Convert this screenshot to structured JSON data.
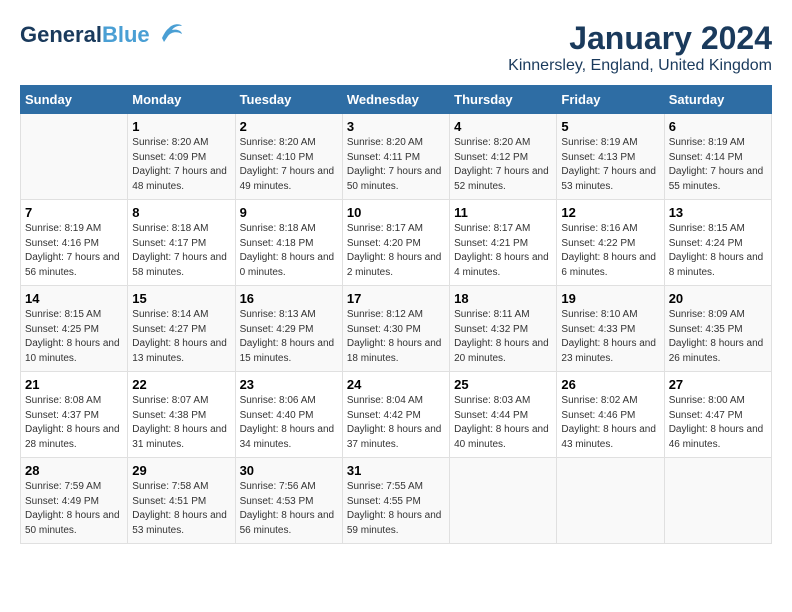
{
  "header": {
    "logo_general": "General",
    "logo_blue": "Blue",
    "main_title": "January 2024",
    "subtitle": "Kinnersley, England, United Kingdom"
  },
  "days_header": [
    "Sunday",
    "Monday",
    "Tuesday",
    "Wednesday",
    "Thursday",
    "Friday",
    "Saturday"
  ],
  "weeks": [
    [
      {
        "date": "",
        "sunrise": "",
        "sunset": "",
        "daylight": ""
      },
      {
        "date": "1",
        "sunrise": "Sunrise: 8:20 AM",
        "sunset": "Sunset: 4:09 PM",
        "daylight": "Daylight: 7 hours and 48 minutes."
      },
      {
        "date": "2",
        "sunrise": "Sunrise: 8:20 AM",
        "sunset": "Sunset: 4:10 PM",
        "daylight": "Daylight: 7 hours and 49 minutes."
      },
      {
        "date": "3",
        "sunrise": "Sunrise: 8:20 AM",
        "sunset": "Sunset: 4:11 PM",
        "daylight": "Daylight: 7 hours and 50 minutes."
      },
      {
        "date": "4",
        "sunrise": "Sunrise: 8:20 AM",
        "sunset": "Sunset: 4:12 PM",
        "daylight": "Daylight: 7 hours and 52 minutes."
      },
      {
        "date": "5",
        "sunrise": "Sunrise: 8:19 AM",
        "sunset": "Sunset: 4:13 PM",
        "daylight": "Daylight: 7 hours and 53 minutes."
      },
      {
        "date": "6",
        "sunrise": "Sunrise: 8:19 AM",
        "sunset": "Sunset: 4:14 PM",
        "daylight": "Daylight: 7 hours and 55 minutes."
      }
    ],
    [
      {
        "date": "7",
        "sunrise": "Sunrise: 8:19 AM",
        "sunset": "Sunset: 4:16 PM",
        "daylight": "Daylight: 7 hours and 56 minutes."
      },
      {
        "date": "8",
        "sunrise": "Sunrise: 8:18 AM",
        "sunset": "Sunset: 4:17 PM",
        "daylight": "Daylight: 7 hours and 58 minutes."
      },
      {
        "date": "9",
        "sunrise": "Sunrise: 8:18 AM",
        "sunset": "Sunset: 4:18 PM",
        "daylight": "Daylight: 8 hours and 0 minutes."
      },
      {
        "date": "10",
        "sunrise": "Sunrise: 8:17 AM",
        "sunset": "Sunset: 4:20 PM",
        "daylight": "Daylight: 8 hours and 2 minutes."
      },
      {
        "date": "11",
        "sunrise": "Sunrise: 8:17 AM",
        "sunset": "Sunset: 4:21 PM",
        "daylight": "Daylight: 8 hours and 4 minutes."
      },
      {
        "date": "12",
        "sunrise": "Sunrise: 8:16 AM",
        "sunset": "Sunset: 4:22 PM",
        "daylight": "Daylight: 8 hours and 6 minutes."
      },
      {
        "date": "13",
        "sunrise": "Sunrise: 8:15 AM",
        "sunset": "Sunset: 4:24 PM",
        "daylight": "Daylight: 8 hours and 8 minutes."
      }
    ],
    [
      {
        "date": "14",
        "sunrise": "Sunrise: 8:15 AM",
        "sunset": "Sunset: 4:25 PM",
        "daylight": "Daylight: 8 hours and 10 minutes."
      },
      {
        "date": "15",
        "sunrise": "Sunrise: 8:14 AM",
        "sunset": "Sunset: 4:27 PM",
        "daylight": "Daylight: 8 hours and 13 minutes."
      },
      {
        "date": "16",
        "sunrise": "Sunrise: 8:13 AM",
        "sunset": "Sunset: 4:29 PM",
        "daylight": "Daylight: 8 hours and 15 minutes."
      },
      {
        "date": "17",
        "sunrise": "Sunrise: 8:12 AM",
        "sunset": "Sunset: 4:30 PM",
        "daylight": "Daylight: 8 hours and 18 minutes."
      },
      {
        "date": "18",
        "sunrise": "Sunrise: 8:11 AM",
        "sunset": "Sunset: 4:32 PM",
        "daylight": "Daylight: 8 hours and 20 minutes."
      },
      {
        "date": "19",
        "sunrise": "Sunrise: 8:10 AM",
        "sunset": "Sunset: 4:33 PM",
        "daylight": "Daylight: 8 hours and 23 minutes."
      },
      {
        "date": "20",
        "sunrise": "Sunrise: 8:09 AM",
        "sunset": "Sunset: 4:35 PM",
        "daylight": "Daylight: 8 hours and 26 minutes."
      }
    ],
    [
      {
        "date": "21",
        "sunrise": "Sunrise: 8:08 AM",
        "sunset": "Sunset: 4:37 PM",
        "daylight": "Daylight: 8 hours and 28 minutes."
      },
      {
        "date": "22",
        "sunrise": "Sunrise: 8:07 AM",
        "sunset": "Sunset: 4:38 PM",
        "daylight": "Daylight: 8 hours and 31 minutes."
      },
      {
        "date": "23",
        "sunrise": "Sunrise: 8:06 AM",
        "sunset": "Sunset: 4:40 PM",
        "daylight": "Daylight: 8 hours and 34 minutes."
      },
      {
        "date": "24",
        "sunrise": "Sunrise: 8:04 AM",
        "sunset": "Sunset: 4:42 PM",
        "daylight": "Daylight: 8 hours and 37 minutes."
      },
      {
        "date": "25",
        "sunrise": "Sunrise: 8:03 AM",
        "sunset": "Sunset: 4:44 PM",
        "daylight": "Daylight: 8 hours and 40 minutes."
      },
      {
        "date": "26",
        "sunrise": "Sunrise: 8:02 AM",
        "sunset": "Sunset: 4:46 PM",
        "daylight": "Daylight: 8 hours and 43 minutes."
      },
      {
        "date": "27",
        "sunrise": "Sunrise: 8:00 AM",
        "sunset": "Sunset: 4:47 PM",
        "daylight": "Daylight: 8 hours and 46 minutes."
      }
    ],
    [
      {
        "date": "28",
        "sunrise": "Sunrise: 7:59 AM",
        "sunset": "Sunset: 4:49 PM",
        "daylight": "Daylight: 8 hours and 50 minutes."
      },
      {
        "date": "29",
        "sunrise": "Sunrise: 7:58 AM",
        "sunset": "Sunset: 4:51 PM",
        "daylight": "Daylight: 8 hours and 53 minutes."
      },
      {
        "date": "30",
        "sunrise": "Sunrise: 7:56 AM",
        "sunset": "Sunset: 4:53 PM",
        "daylight": "Daylight: 8 hours and 56 minutes."
      },
      {
        "date": "31",
        "sunrise": "Sunrise: 7:55 AM",
        "sunset": "Sunset: 4:55 PM",
        "daylight": "Daylight: 8 hours and 59 minutes."
      },
      {
        "date": "",
        "sunrise": "",
        "sunset": "",
        "daylight": ""
      },
      {
        "date": "",
        "sunrise": "",
        "sunset": "",
        "daylight": ""
      },
      {
        "date": "",
        "sunrise": "",
        "sunset": "",
        "daylight": ""
      }
    ]
  ]
}
